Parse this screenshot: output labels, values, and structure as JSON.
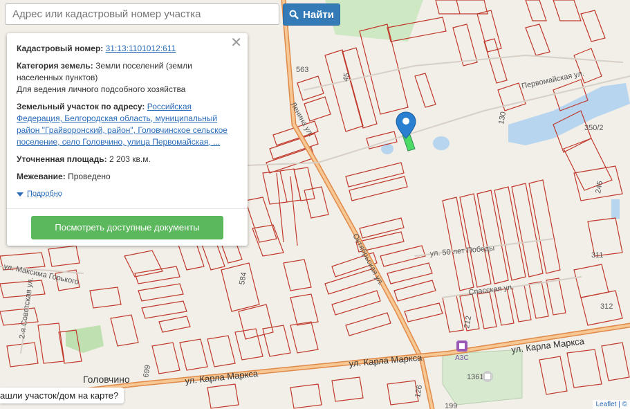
{
  "search": {
    "placeholder": "Адрес или кадастровый номер участка",
    "button_label": "Найти",
    "button_icon": "search-icon"
  },
  "panel": {
    "close_icon": "close-icon",
    "cadastral_label": "Кадастровый номер:",
    "cadastral_value": "31:13:1101012:611",
    "category_label": "Категория земель:",
    "category_value": "Земли поселений (земли населенных пунктов)",
    "usage_value": "Для ведения личного подсобного хозяйства",
    "address_label": "Земельный участок по адресу:",
    "address_value": "Российская Федерация, Белгородская область, муниципальный район \"Грайворонский, район\", Головчинское сельское поселение, село Головчино, улица Первомайская, ...",
    "area_label": "Уточненная площадь:",
    "area_value": "2 203 кв.м.",
    "survey_label": "Межевание:",
    "survey_value": "Проведено",
    "details_label": "Подробно",
    "docs_button": "Посмотреть доступные документы"
  },
  "map": {
    "labels": {
      "road_563": "563",
      "pervomaiskaya": "Первомайская ул.",
      "lenina": "Ленина ул.",
      "oktyabrskaya": "Октябрьская ул.",
      "n_350_2": "350/2",
      "n_130": "130",
      "n_245": "245",
      "n_311": "311",
      "n_312": "312",
      "n_584": "584",
      "n_45": "45",
      "n_1361": "1361",
      "n_212": "212",
      "n_126": "126",
      "n_199": "199",
      "n_699": "699",
      "pobedy": "ул. 50 лет Победы",
      "spasskaya": "Спасская ул.",
      "gorkogo": "ул. Максима Горького",
      "sovetskaya": "2-я Советская ул.",
      "karla_marksa_1": "ул. Карла Маркса",
      "karla_marksa_2": "ул. Карла Маркса",
      "karla_marksa_3": "ул. Карла Маркса",
      "golovchino": "Головчино",
      "azs": "АЗС"
    }
  },
  "found_prompt": "ашли участок/дом на карте?",
  "attribution": "Leaflet | ©",
  "colors": {
    "parcel": "#c0392b",
    "road": "#e8a06a",
    "water": "#b7d5ef",
    "green": "#cfe8c4",
    "marker": "#2a7fd0",
    "selected": "#4cd964"
  }
}
